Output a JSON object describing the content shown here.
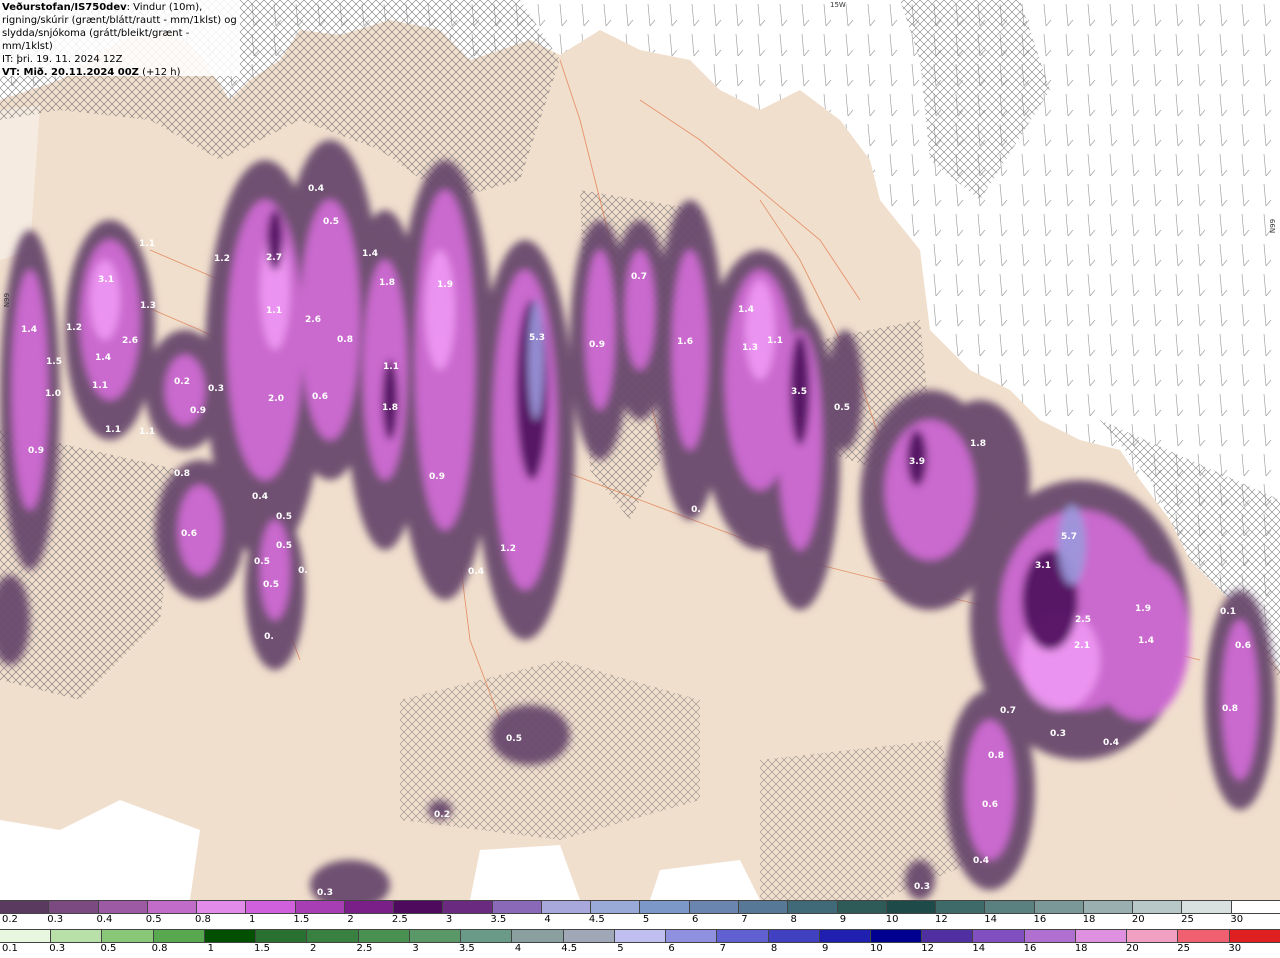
{
  "header": {
    "source": "Veðurstofan/IS750dev",
    "description": ": Vindur (10m), rigning/skúrir (grænt/blátt/rautt - mm/1klst) og slydda/snjókoma (grátt/bleikt/grænt - mm/1klst)",
    "issue_time": "IT: þri. 19. 11. 2024 12Z",
    "valid_label": "VT: Mið. 20.11.2024 00Z",
    "lead_time": " (+12 h)"
  },
  "edge_labels": {
    "top": "15W",
    "left": "N99",
    "right": "N99"
  },
  "precip_labels": [
    {
      "text": "0.4"
    },
    {
      "text": "0.5"
    },
    {
      "text": "1.1"
    },
    {
      "text": "1.4"
    },
    {
      "text": "1.2"
    },
    {
      "text": "2.7"
    },
    {
      "text": "3.1"
    },
    {
      "text": "1.8"
    },
    {
      "text": "1.3"
    },
    {
      "text": "1.4"
    },
    {
      "text": "1.2"
    },
    {
      "text": "1.5"
    },
    {
      "text": "2.6"
    },
    {
      "text": "1.9"
    },
    {
      "text": "1.1"
    },
    {
      "text": "2.6"
    },
    {
      "text": "1.4"
    },
    {
      "text": "1.0"
    },
    {
      "text": "1.1"
    },
    {
      "text": "0.8"
    },
    {
      "text": "0.2"
    },
    {
      "text": "0.3"
    },
    {
      "text": "2.0"
    },
    {
      "text": "1.1"
    },
    {
      "text": "0.6"
    },
    {
      "text": "1.1"
    },
    {
      "text": "0.9"
    },
    {
      "text": "1.8"
    },
    {
      "text": "5.3"
    },
    {
      "text": "0.9"
    },
    {
      "text": "0.7"
    },
    {
      "text": "1.6"
    },
    {
      "text": "1.4"
    },
    {
      "text": "1.3"
    },
    {
      "text": "1.1"
    },
    {
      "text": "3.5"
    },
    {
      "text": "0.5"
    },
    {
      "text": "1.1"
    },
    {
      "text": "0.9"
    },
    {
      "text": "0.8"
    },
    {
      "text": "0.9"
    },
    {
      "text": "0.4"
    },
    {
      "text": "0.5"
    },
    {
      "text": "0.6"
    },
    {
      "text": "0.5"
    },
    {
      "text": "0.5"
    },
    {
      "text": "0.5"
    },
    {
      "text": "0."
    },
    {
      "text": "0."
    },
    {
      "text": "1.2"
    },
    {
      "text": "0.4"
    },
    {
      "text": "0."
    },
    {
      "text": "3.9"
    },
    {
      "text": "1.8"
    },
    {
      "text": "5.7"
    },
    {
      "text": "3.1"
    },
    {
      "text": "1.9"
    },
    {
      "text": "2.5"
    },
    {
      "text": "1.4"
    },
    {
      "text": "2.1"
    },
    {
      "text": "0.6"
    },
    {
      "text": "0.8"
    },
    {
      "text": "0.7"
    },
    {
      "text": "0.3"
    },
    {
      "text": "0.4"
    },
    {
      "text": "0.8"
    },
    {
      "text": "0.6"
    },
    {
      "text": "0.4"
    },
    {
      "text": "0.3"
    },
    {
      "text": "0.5"
    },
    {
      "text": "0.2"
    },
    {
      "text": "0.3"
    },
    {
      "text": "1.2"
    },
    {
      "text": "0.1"
    }
  ],
  "legend_snow": {
    "ticks": [
      "0.2",
      "0.3",
      "0.4",
      "0.5",
      "0.8",
      "1",
      "1.5",
      "2",
      "2.5",
      "3",
      "3.5",
      "4",
      "4.5",
      "5",
      "6",
      "7",
      "8",
      "9",
      "10",
      "12",
      "14",
      "16",
      "18",
      "20",
      "25",
      "30"
    ],
    "colors": [
      "#5a3a5e",
      "#7a4a80",
      "#9b5aa3",
      "#c06cc8",
      "#e28be8",
      "#d060dc",
      "#a83eb4",
      "#7a1e88",
      "#4e0a5c",
      "#6a2a80",
      "#8a6ab8",
      "#a8a8dc",
      "#9aaad8",
      "#7c98c8",
      "#6a86b0",
      "#587898",
      "#406a78",
      "#2e5a58",
      "#1e4a4a",
      "#3e6a6a",
      "#5a8080",
      "#7a9898",
      "#9ab0b0",
      "#b8c8c8",
      "#d8e0e0",
      "#ffffff"
    ]
  },
  "legend_rain": {
    "ticks": [
      "0.1",
      "0.3",
      "0.5",
      "0.8",
      "1",
      "1.5",
      "2",
      "2.5",
      "3",
      "3.5",
      "4",
      "4.5",
      "5",
      "6",
      "7",
      "8",
      "9",
      "10",
      "12",
      "14",
      "16",
      "18",
      "20",
      "25",
      "30"
    ],
    "colors": [
      "#e8f8e0",
      "#b8e0a8",
      "#88c878",
      "#58a850",
      "#005000",
      "#2a7030",
      "#3a8040",
      "#4a9050",
      "#5a9868",
      "#6a9a88",
      "#8aa0a0",
      "#a0a8b8",
      "#c0c0f0",
      "#9090e0",
      "#6060d0",
      "#4040c0",
      "#2020b0",
      "#000090",
      "#5030a0",
      "#8050c0",
      "#b070d0",
      "#e090e0",
      "#f0a0c0",
      "#f06070",
      "#e02020"
    ]
  }
}
